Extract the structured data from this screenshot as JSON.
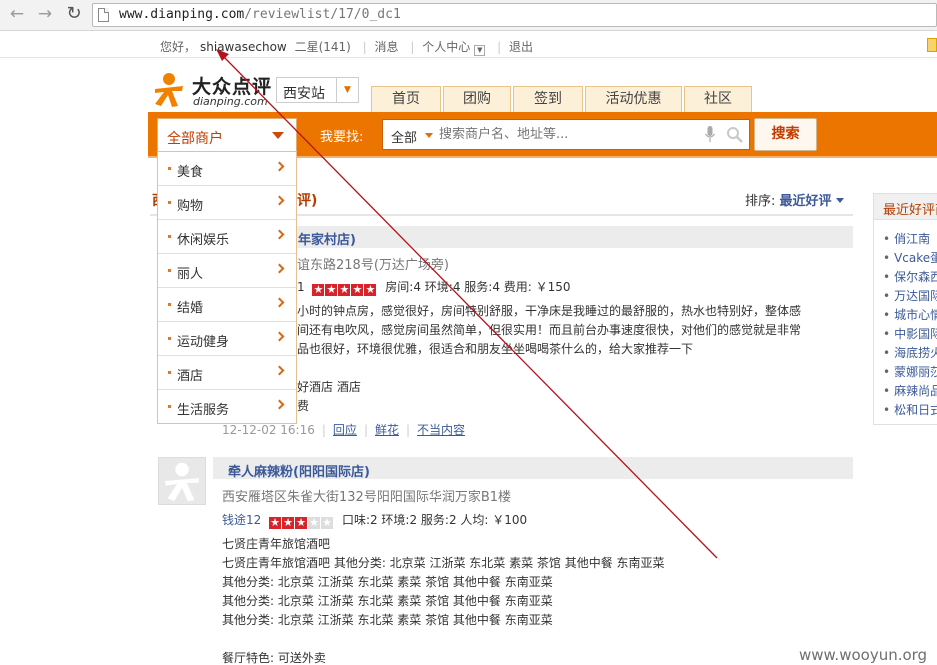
{
  "browser": {
    "url_host": "www.dianping.com",
    "url_path": "/reviewlist/17/0_dc1"
  },
  "topbar": {
    "greeting": "您好，",
    "username": "shiawasechow",
    "level": "二星(141)",
    "messages": "消息",
    "user_center": "个人中心",
    "logout": "退出"
  },
  "logo": {
    "cn": "大众点评",
    "en": "dianping.com"
  },
  "city": {
    "name": "西安站"
  },
  "nav_tabs": [
    "首页",
    "团购",
    "签到",
    "活动优惠",
    "社区"
  ],
  "search": {
    "all_shops": "全部商户",
    "want_find": "我要找:",
    "category": "全部",
    "placeholder": "搜索商户名、地址等...",
    "button": "搜索"
  },
  "dropdown": [
    "美食",
    "购物",
    "休闲娱乐",
    "丽人",
    "结婚",
    "运动健身",
    "酒店",
    "生活服务"
  ],
  "section": {
    "title_left": "西",
    "title_right": "评)",
    "sort_label": "排序:",
    "sort_value": "最近好评"
  },
  "review1": {
    "title": "年家村店)",
    "address": "谊东路218号(万达广场旁)",
    "rating_prefix": "1",
    "stars_on": 5,
    "stars_total": 5,
    "scores": "房间:4  环境:4  服务:4  费用: ￥150",
    "lines": [
      "小时的钟点房，感觉很好，房间特别舒服，干净床是我睡过的最舒服的，热水也特别好，整体感",
      "间还有电吹风，感觉房间虽然简单，但很实用！而且前台办事速度很快，对他们的感觉就是非常",
      "品也很好，环境很优雅，很适合和朋友坐坐喝喝茶什么的，给大家推荐一下"
    ],
    "tags_line": "好酒店 酒店",
    "tail_word": "费",
    "time": "12-12-02 16:16",
    "actions": [
      "回应",
      "鲜花",
      "不当内容"
    ]
  },
  "review2": {
    "title": "牵人麻辣粉(阳阳国际店)",
    "address": "西安雁塔区朱雀大街132号阳阳国际华润万家B1楼",
    "user": "钱途12",
    "stars_on": 3,
    "stars_total": 5,
    "scores": "口味:2  环境:2  服务:2  人均: ￥100",
    "lines": [
      "七贤庄青年旅馆酒吧",
      "七贤庄青年旅馆酒吧 其他分类:  北京菜  江浙菜  东北菜  素菜  茶馆  其他中餐  东南亚菜",
      "其他分类:  北京菜  江浙菜  东北菜  素菜  茶馆  其他中餐  东南亚菜",
      "其他分类:  北京菜  江浙菜  东北菜  素菜  茶馆  其他中餐  东南亚菜",
      "其他分类:  北京菜  江浙菜  东北菜  素菜  茶馆  其他中餐  东南亚菜"
    ],
    "feature": "餐厅特色: 可送外卖"
  },
  "sidebar": {
    "title": "最近好评商",
    "items": [
      "俏江南",
      "Vcake蛋",
      "保尔森西",
      "万达国际",
      "城市心情",
      "中影国际",
      "海底捞火",
      "蒙娜丽莎",
      "麻辣尚品",
      "松和日式"
    ]
  },
  "watermark": "www.wooyun.org",
  "colors": {
    "brand_orange": "#ec7500",
    "link_blue": "#3c5a99",
    "heading_red": "#b23d00",
    "star_red": "#d8232a",
    "annotation_red": "#b3131b"
  }
}
